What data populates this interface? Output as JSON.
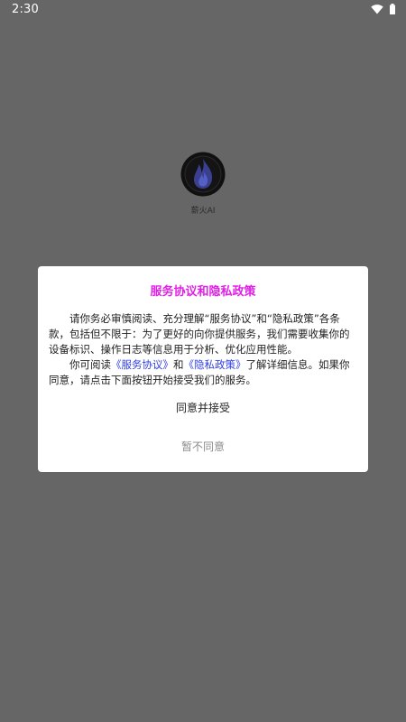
{
  "status_bar": {
    "time": "2:30",
    "wifi_icon": "wifi-icon",
    "battery_icon": "battery-icon"
  },
  "app": {
    "name": "薪火AI",
    "logo_icon": "flame-logo-icon"
  },
  "dialog": {
    "title": "服务协议和隐私政策",
    "paragraph1": "请你务必审慎阅读、充分理解“服务协议”和“隐私政策”各条款，包括但不限于：为了更好的向你提供服务，我们需要收集你的设备标识、操作日志等信息用于分析、优化应用性能。",
    "paragraph2_prefix": "你可阅读",
    "service_link": "《服务协议》",
    "paragraph2_and": "和",
    "privacy_link": "《隐私政策》",
    "paragraph2_suffix": "了解详细信息。如果你同意，请点击下面按钮开始接受我们的服务。",
    "agree_label": "同意并接受",
    "disagree_label": "暂不同意"
  },
  "colors": {
    "overlay": "#666666",
    "title": "#e020e6",
    "link": "#2e3ee8",
    "disagree_text": "#8c8c8c"
  }
}
